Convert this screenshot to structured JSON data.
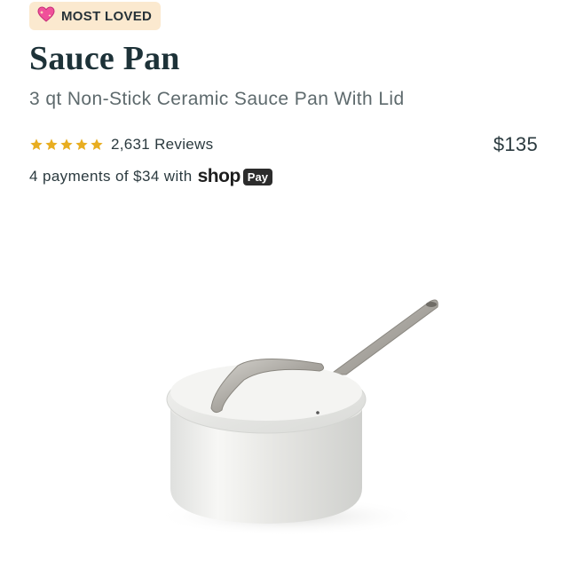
{
  "badge": {
    "icon": "sparkling-heart-icon",
    "label": "MOST LOVED"
  },
  "product": {
    "title": "Sauce Pan",
    "subtitle": "3 qt Non-Stick Ceramic Sauce Pan With Lid",
    "rating": {
      "stars": 5,
      "max": 5,
      "reviews_label": "2,631 Reviews"
    },
    "price": "$135",
    "installments": {
      "text": "4 payments of $34 with",
      "provider_shop": "shop",
      "provider_pay": "Pay"
    },
    "image": {
      "subject": "sauce-pan"
    }
  },
  "colors": {
    "badge_bg": "#fbe9cf",
    "title": "#1d3238",
    "star": "#e8ad20",
    "pay_box": "#2c2c2c"
  }
}
